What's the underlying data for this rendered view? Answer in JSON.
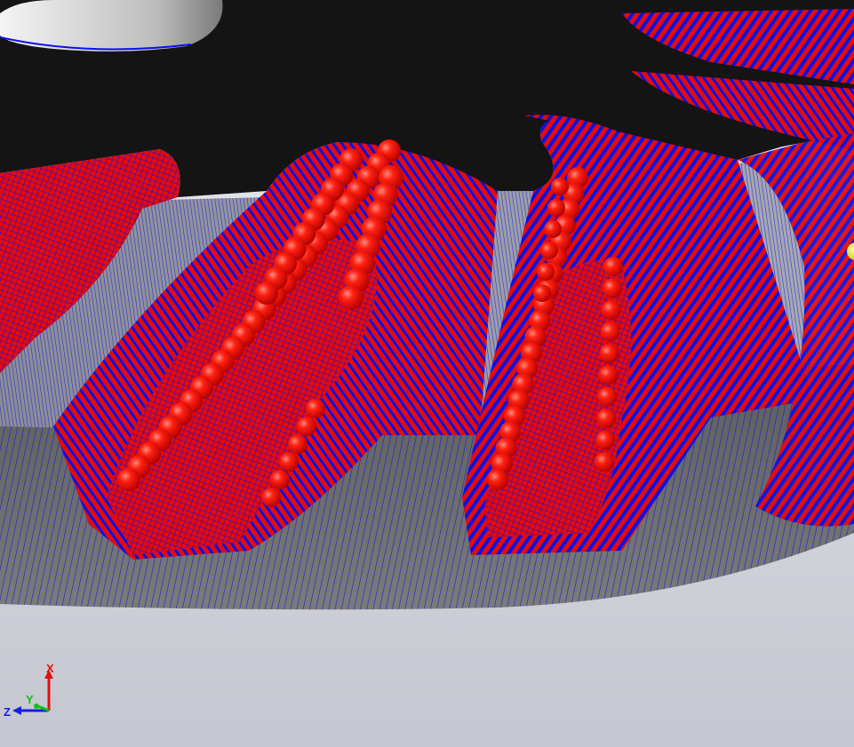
{
  "viewport": {
    "background_top": "#e8e8ee",
    "background_bottom": "#c8c8d2",
    "colors": {
      "part_top_face": "#141414",
      "part_side_face": "#6a6a6a",
      "wall_face": "#9a9aa4",
      "toolpath_blue": "#0a12e6",
      "toolpath_red": "#e60a0a",
      "tool_ball": "#ff1a10",
      "marker_yellow": "#e8e820"
    }
  },
  "triad": {
    "x_label": "X",
    "y_label": "Y",
    "z_label": "Z",
    "x_color": "#e01010",
    "y_color": "#10c010",
    "z_color": "#1020e0"
  }
}
